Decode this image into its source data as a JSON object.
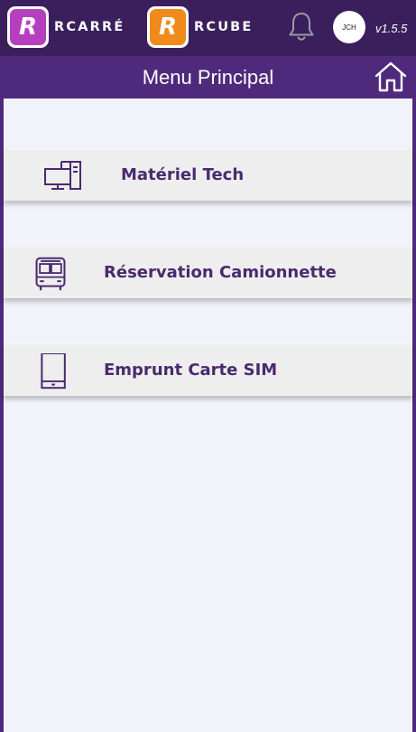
{
  "topbar": {
    "brand1": {
      "letter": "R",
      "name": "RCARRÉ",
      "color": "#b63fbf"
    },
    "brand2": {
      "letter": "R",
      "name": "RCUBE",
      "color": "#f08a1a"
    },
    "bell_icon": "bell-icon",
    "avatar_initials": "JCH",
    "version": "v1.5.5",
    "background": "#3a1f5c"
  },
  "header": {
    "title": "Menu Principal",
    "home_icon": "home-icon",
    "background": "#4f2a7c"
  },
  "menu": {
    "items": [
      {
        "label": "Matériel Tech",
        "icon": "desktop-computer-icon"
      },
      {
        "label": "Réservation Camionnette",
        "icon": "bus-icon"
      },
      {
        "label": "Emprunt Carte SIM",
        "icon": "tablet-icon"
      }
    ],
    "text_color": "#4a2a6e"
  }
}
